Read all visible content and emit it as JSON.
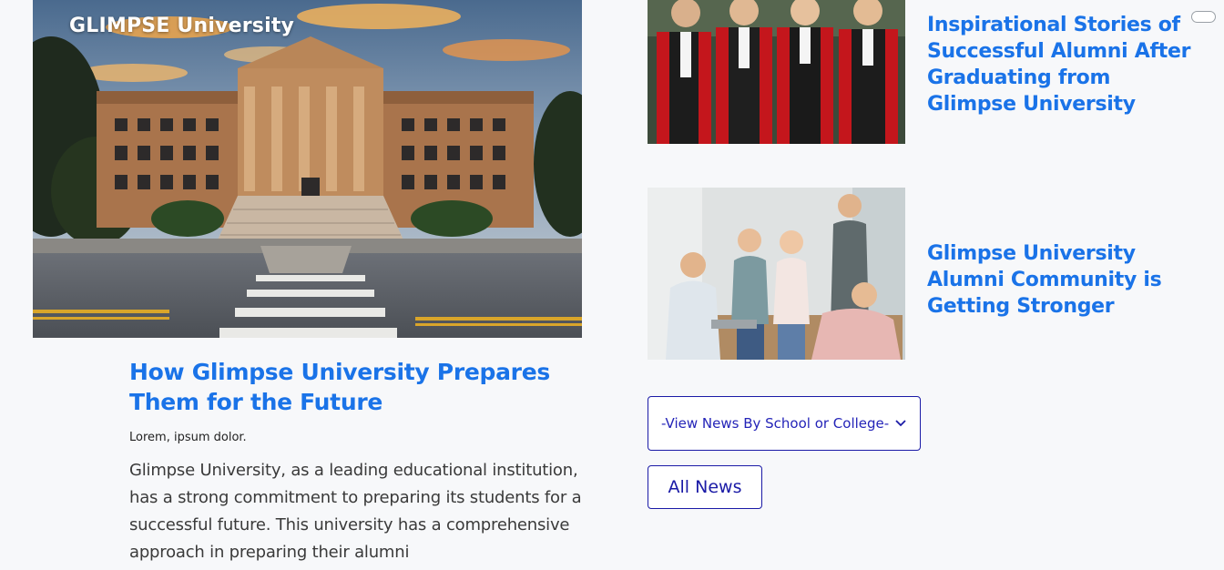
{
  "hero": {
    "brand": "GLIMPSE University",
    "image_icon": "campus-building-photo"
  },
  "main_article": {
    "title": "How Glimpse University Prepares Them for the Future",
    "meta": "Lorem, ipsum dolor.",
    "excerpt": "Glimpse University, as a leading educational institution, has a strong commitment to preparing its students for a successful future. This university has a comprehensive approach in preparing their alumni"
  },
  "side_news": [
    {
      "title": "Inspirational Stories of Successful Alumni After Graduating from Glimpse University",
      "image_icon": "graduates-photo"
    },
    {
      "title": "Glimpse University Alumni Community is Getting Stronger",
      "image_icon": "students-meeting-photo"
    }
  ],
  "controls": {
    "school_select": "-View News By School or College-",
    "all_news": "All News"
  },
  "colors": {
    "title_blue": "#1a73e8",
    "control_navy": "#1a1aa6",
    "background": "#f7f8fa"
  }
}
